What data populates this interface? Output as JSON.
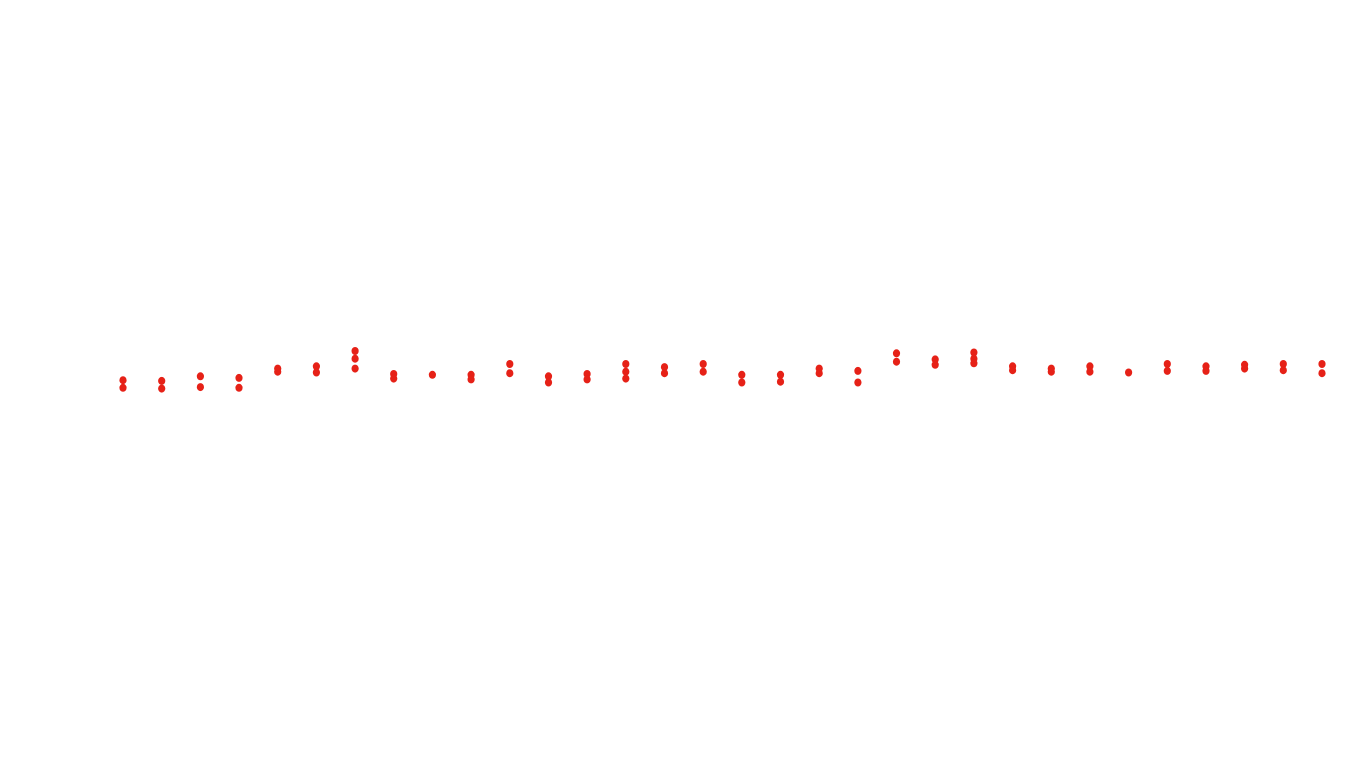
{
  "chart_data": {
    "type": "scatter",
    "title": "",
    "xlabel": "",
    "ylabel": "",
    "grid": false,
    "legend": "none",
    "marker_color": "#e62117",
    "x_count": 32,
    "ylim": [
      0,
      100
    ],
    "series": [
      {
        "name": "points",
        "points": [
          {
            "x": 1,
            "y": [
              50.5,
              49.5
            ]
          },
          {
            "x": 2,
            "y": [
              50.4,
              49.4
            ]
          },
          {
            "x": 3,
            "y": [
              51.0,
              49.6
            ]
          },
          {
            "x": 4,
            "y": [
              50.8,
              49.5
            ]
          },
          {
            "x": 5,
            "y": [
              52.0,
              51.6
            ]
          },
          {
            "x": 6,
            "y": [
              52.3,
              51.5
            ]
          },
          {
            "x": 7,
            "y": [
              54.3,
              53.3,
              52.0
            ]
          },
          {
            "x": 8,
            "y": [
              51.3,
              50.7
            ]
          },
          {
            "x": 9,
            "y": [
              51.2
            ]
          },
          {
            "x": 10,
            "y": [
              51.2,
              50.6
            ]
          },
          {
            "x": 11,
            "y": [
              52.6,
              51.4
            ]
          },
          {
            "x": 12,
            "y": [
              51.0,
              50.2
            ]
          },
          {
            "x": 13,
            "y": [
              51.3,
              50.6
            ]
          },
          {
            "x": 14,
            "y": [
              52.6,
              51.6,
              50.7
            ]
          },
          {
            "x": 15,
            "y": [
              52.2,
              51.4
            ]
          },
          {
            "x": 16,
            "y": [
              52.6,
              51.6
            ]
          },
          {
            "x": 17,
            "y": [
              51.2,
              50.2
            ]
          },
          {
            "x": 18,
            "y": [
              51.2,
              50.3
            ]
          },
          {
            "x": 19,
            "y": [
              52.0,
              51.4
            ]
          },
          {
            "x": 20,
            "y": [
              51.7,
              50.2
            ]
          },
          {
            "x": 21,
            "y": [
              54.0,
              52.9
            ]
          },
          {
            "x": 22,
            "y": [
              53.2,
              52.5
            ]
          },
          {
            "x": 23,
            "y": [
              54.1,
              53.3,
              52.7
            ]
          },
          {
            "x": 24,
            "y": [
              52.3,
              51.8
            ]
          },
          {
            "x": 25,
            "y": [
              52.0,
              51.6
            ]
          },
          {
            "x": 26,
            "y": [
              52.3,
              51.6
            ]
          },
          {
            "x": 27,
            "y": [
              51.5
            ]
          },
          {
            "x": 28,
            "y": [
              52.6,
              51.7
            ]
          },
          {
            "x": 29,
            "y": [
              52.3,
              51.7
            ]
          },
          {
            "x": 30,
            "y": [
              52.5,
              52.0
            ]
          },
          {
            "x": 31,
            "y": [
              52.6,
              51.8
            ]
          },
          {
            "x": 32,
            "y": [
              52.6,
              51.4
            ]
          }
        ]
      }
    ]
  }
}
